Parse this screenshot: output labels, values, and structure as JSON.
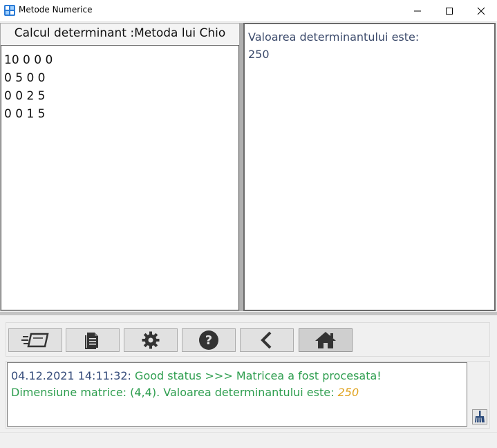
{
  "window": {
    "title": "Metode Numerice",
    "controls": [
      "minimize",
      "maximize",
      "close"
    ]
  },
  "left_panel": {
    "header": "Calcul determinant :Metoda lui Chio",
    "matrix_lines": [
      "10 0 0 0",
      "0 5 0 0",
      "0 0 2 5",
      "0 0 1 5"
    ]
  },
  "right_panel": {
    "result_label": "Valoarea determinantului este:",
    "result_value": "250"
  },
  "toolbar": {
    "buttons": [
      {
        "name": "fast-input-icon"
      },
      {
        "name": "document-icon"
      },
      {
        "name": "gear-icon"
      },
      {
        "name": "help-icon"
      },
      {
        "name": "back-icon"
      },
      {
        "name": "home-icon"
      }
    ]
  },
  "log": {
    "timestamp": "04.12.2021 14:11:32:",
    "status_message": " Good status >>> Matricea a fost procesata!",
    "detail_prefix": "Dimensiune matrice: (4,4). Valoarea determinantului este: ",
    "detail_value": "250"
  },
  "colors": {
    "status_green": "#2e9e4f",
    "timestamp_blue": "#344b7a",
    "value_orange": "#e0a21d",
    "result_text": "#3b4a6b"
  }
}
